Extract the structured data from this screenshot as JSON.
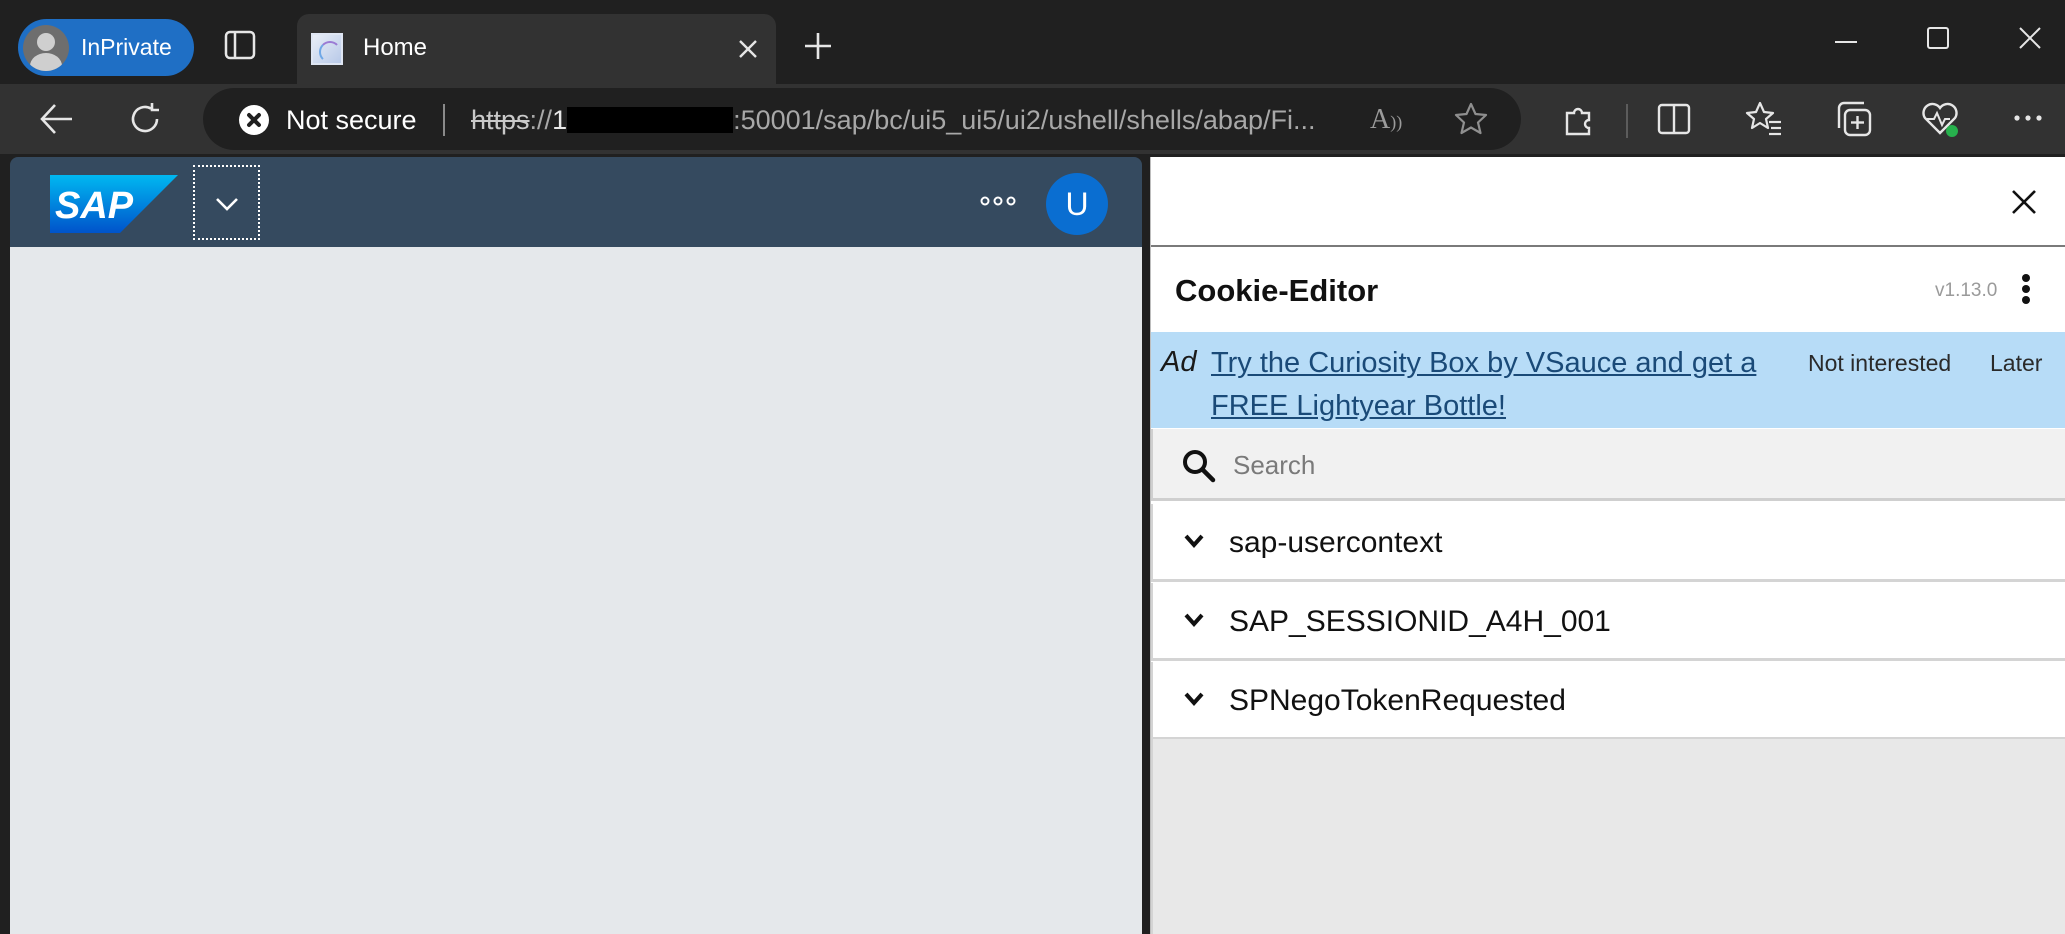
{
  "browser": {
    "profile_label": "InPrivate",
    "tab_title": "Home",
    "security_label": "Not secure",
    "url_scheme": "https",
    "url_sep": "://",
    "url_host_start": "1",
    "url_rest": ":50001/sap/bc/ui5_ui5/ui2/ushell/shells/abap/Fi...",
    "read_aloud_glyph": "A"
  },
  "sap": {
    "logo_text": "SAP",
    "avatar_initial": "U",
    "brand_color": "#0a6ed1",
    "shell_color": "#354a5f"
  },
  "cookie_editor": {
    "title": "Cookie-Editor",
    "version": "v1.13.0",
    "ad": {
      "tag": "Ad",
      "link_text": "Try the Curiosity Box by VSauce and get a FREE Lightyear Bottle!",
      "not_interested": "Not interested",
      "later": "Later"
    },
    "search_placeholder": "Search",
    "cookies": [
      {
        "name": "sap-usercontext"
      },
      {
        "name": "SAP_SESSIONID_A4H_001"
      },
      {
        "name": "SPNegoTokenRequested"
      }
    ]
  }
}
